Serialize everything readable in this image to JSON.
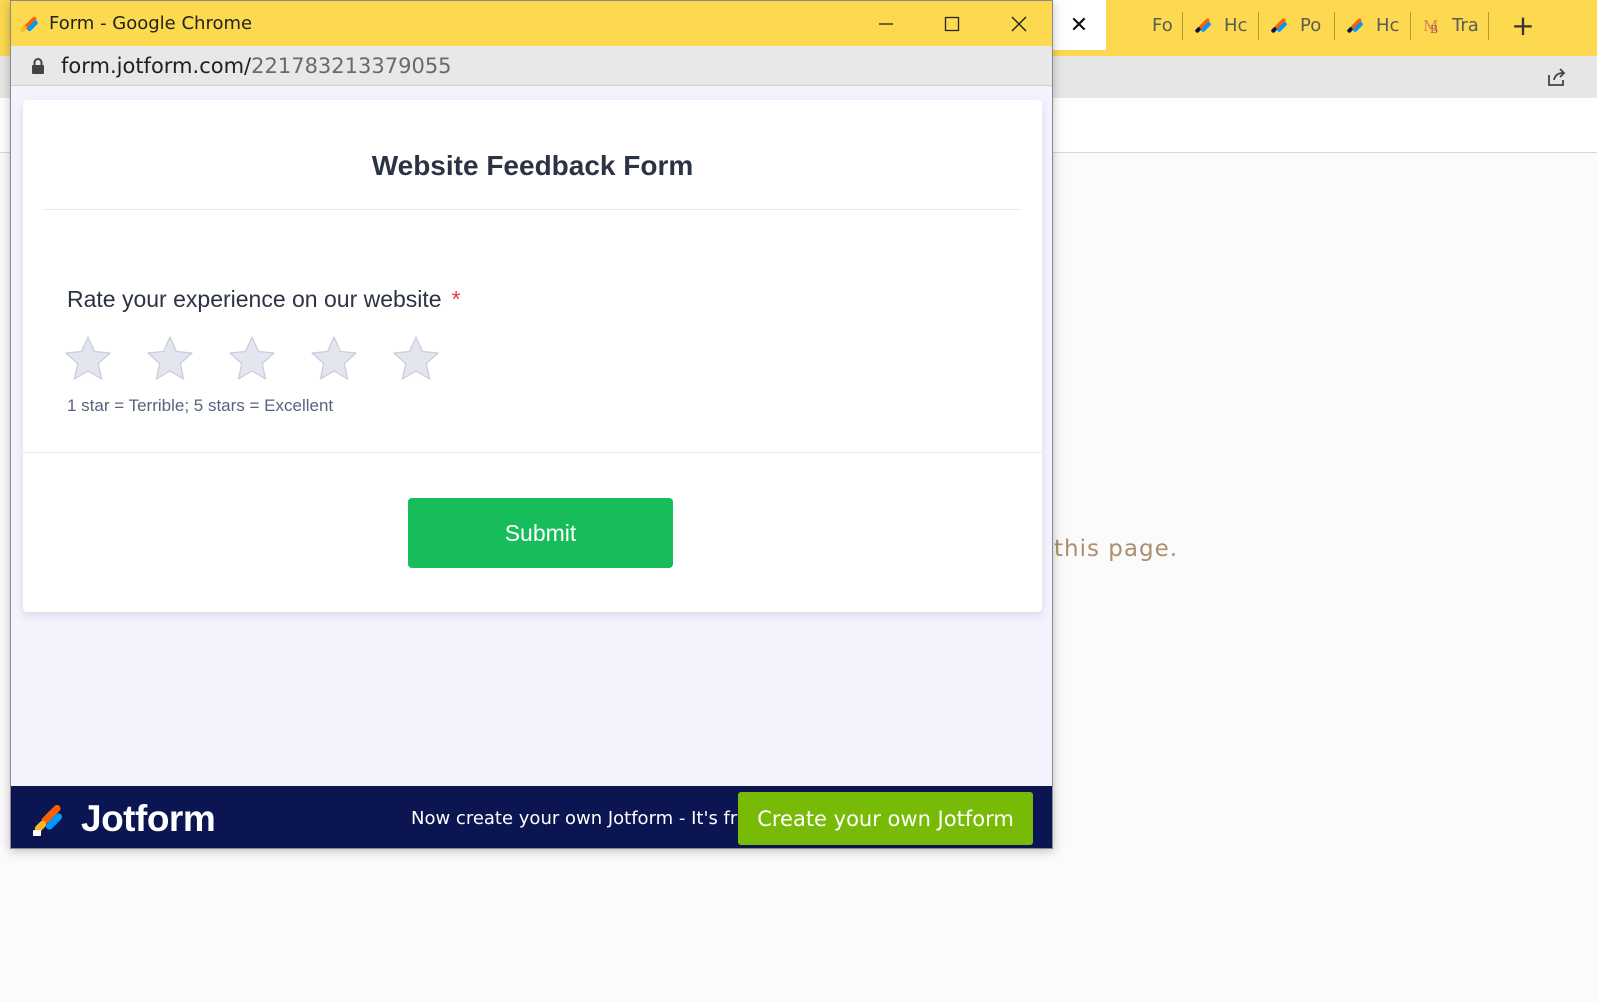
{
  "background_browser": {
    "tabs": [
      {
        "label": "Fo",
        "icon": "jotform-icon"
      },
      {
        "label": "Hc",
        "icon": "jotform-icon"
      },
      {
        "label": "Po",
        "icon": "jotform-icon"
      },
      {
        "label": "Hc",
        "icon": "jotform-icon"
      },
      {
        "label": "Tra",
        "icon": "mb-logo-icon"
      }
    ],
    "close_tab_glyph": "✕",
    "new_tab_glyph": "+",
    "page_text": "this page."
  },
  "popup": {
    "window_title": "Form - Google Chrome",
    "url_host": "form.jotform.com/",
    "url_path": "221783213379055",
    "form": {
      "title": "Website Feedback Form",
      "question_label": "Rate your experience on our website",
      "required_marker": "*",
      "star_count": 5,
      "rating_selected": 0,
      "sublabel": "1 star = Terrible; 5 stars = Excellent",
      "submit_label": "Submit"
    },
    "footer": {
      "brand": "Jotform",
      "promo_text": "Now create your own Jotform - It's free!",
      "cta_label": "Create your own Jotform"
    }
  },
  "colors": {
    "chrome_tabbar": "#fcd94f",
    "submit_green": "#18bd5b",
    "footer_navy": "#0a1551",
    "cta_green": "#78bb07",
    "required_red": "#f23a3c",
    "star_fill": "#e3e5ef"
  }
}
